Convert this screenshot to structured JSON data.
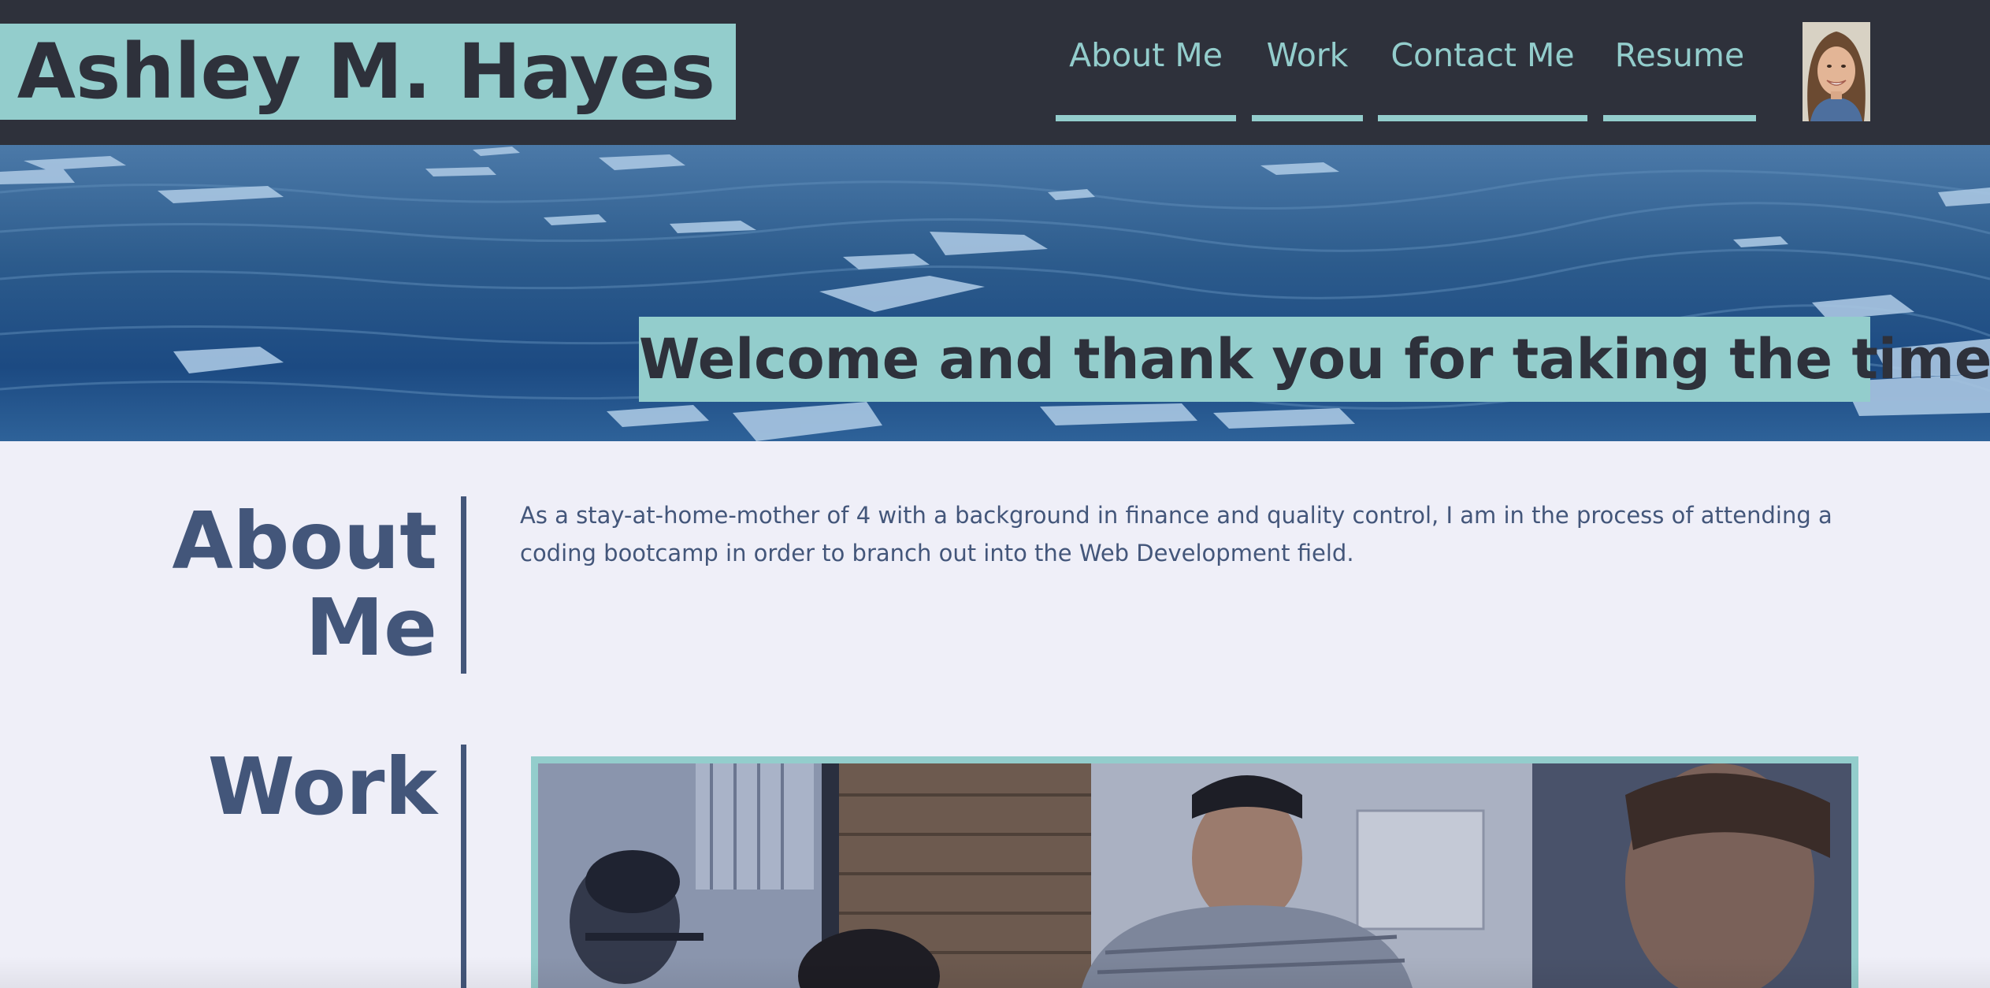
{
  "header": {
    "title": "Ashley M. Hayes",
    "nav": {
      "about": "About Me",
      "work": "Work",
      "contact": "Contact Me",
      "resume": "Resume"
    },
    "avatar_icon": "profile-photo"
  },
  "hero": {
    "banner": "Welcome and thank you for taking the time."
  },
  "about": {
    "heading_line1": "About",
    "heading_line2": "Me",
    "text": "As a stay-at-home-mother of 4 with a background in finance and quality control, I am in the process of attending a coding bootcamp in order to branch out into the Web Development field."
  },
  "work": {
    "heading": "Work"
  },
  "colors": {
    "header_bg": "#2e313b",
    "accent": "#93cdcc",
    "page_bg": "#efeff8",
    "section_text": "#43567a"
  }
}
